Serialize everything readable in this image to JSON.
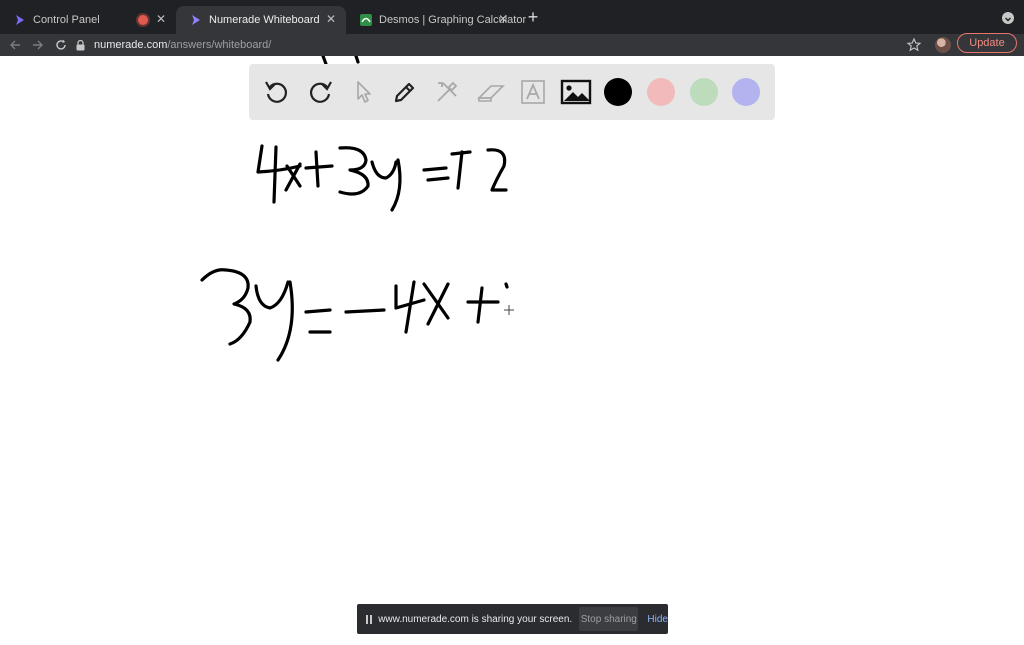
{
  "browser": {
    "tabs": [
      {
        "title": "Control Panel",
        "recording": true,
        "active": false
      },
      {
        "title": "Numerade Whiteboard",
        "active": true
      },
      {
        "title": "Desmos | Graphing Calculator",
        "active": false
      }
    ],
    "address": {
      "host": "numerade.com",
      "path": "/answers/whiteboard/"
    },
    "update_label": "Update"
  },
  "whiteboard": {
    "tools": [
      "undo-icon",
      "redo-icon",
      "pointer-icon",
      "pen-icon",
      "shapes-icon",
      "eraser-icon",
      "text-icon",
      "image-icon"
    ],
    "colors": [
      {
        "name": "black",
        "hex": "#000000"
      },
      {
        "name": "pink",
        "hex": "#f2baba"
      },
      {
        "name": "green",
        "hex": "#bcdcbc"
      },
      {
        "name": "purple",
        "hex": "#b3b3ef"
      }
    ],
    "handwriting": [
      "4x+3y=12",
      "3y=-4x+"
    ]
  },
  "share_bar": {
    "message": "www.numerade.com is sharing your screen.",
    "stop_label": "Stop sharing",
    "hide_label": "Hide"
  }
}
